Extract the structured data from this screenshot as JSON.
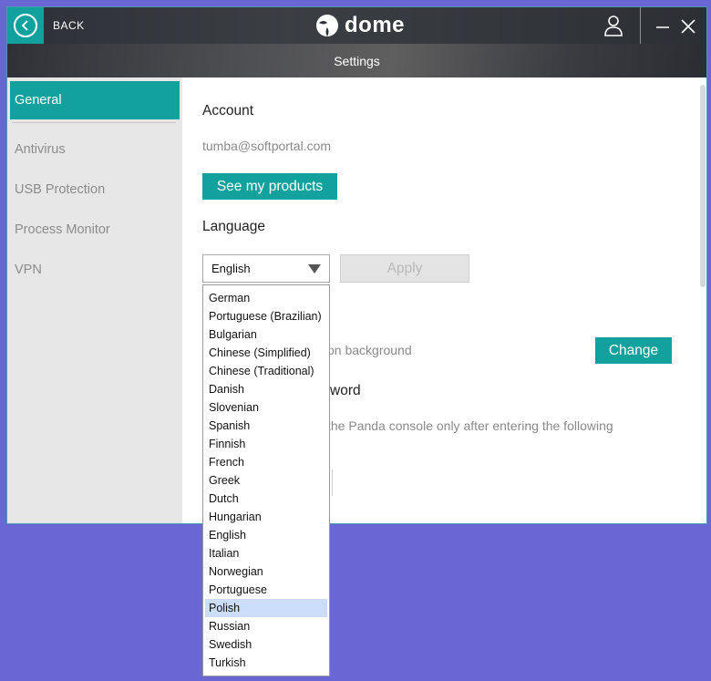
{
  "header": {
    "back_label": "BACK",
    "logo_small": "Panda",
    "logo_word": "dome",
    "page_title": "Settings"
  },
  "sidebar": {
    "items": [
      {
        "label": "General"
      },
      {
        "label": "Antivirus"
      },
      {
        "label": "USB Protection"
      },
      {
        "label": "Process Monitor"
      },
      {
        "label": "VPN"
      }
    ]
  },
  "account": {
    "heading": "Account",
    "email": "tumba@softportal.com",
    "products_button": "See my products"
  },
  "language": {
    "heading": "Language",
    "selected": "English",
    "apply_button": "Apply",
    "options": [
      "German",
      "Portuguese (Brazilian)",
      "Bulgarian",
      "Chinese (Simplified)",
      "Chinese (Traditional)",
      "Danish",
      "Slovenian",
      "Spanish",
      "Finnish",
      "French",
      "Greek",
      "Dutch",
      "Hungarian",
      "English",
      "Italian",
      "Norwegian",
      "Portuguese",
      "Polish",
      "Russian",
      "Swedish",
      "Turkish"
    ],
    "highlighted": "Polish"
  },
  "background": {
    "text_partial": "on background",
    "change_button": "Change"
  },
  "password": {
    "heading_partial": "word",
    "text_partial": "the Panda console only after entering the following"
  },
  "colors": {
    "accent": "#12a19c",
    "desktop": "#6a67d4",
    "sidebar_bg": "#e7e7e7",
    "highlight": "#ccdcfb"
  }
}
